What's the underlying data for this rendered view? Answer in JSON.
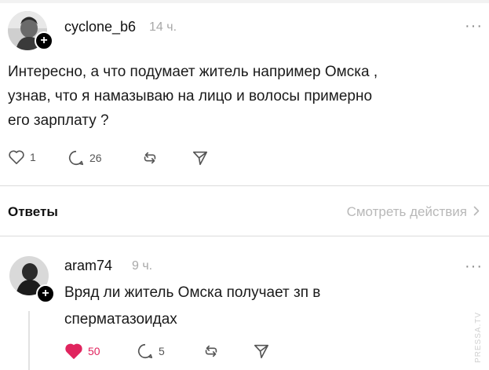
{
  "post": {
    "username": "cyclone_b6",
    "time": "14 ч.",
    "text_lines": [
      "Интересно, а что подумает житель например Омска ,",
      "узнав,  что я намазываю на лицо и волосы примерно",
      "его зарплату ?"
    ],
    "likes": "1",
    "comments": "26"
  },
  "replies_header": {
    "title": "Ответы",
    "see_actions": "Смотреть действия"
  },
  "reply": {
    "username": "aram74",
    "time": "9 ч.",
    "text_lines": [
      "Вряд ли житель Омска получает зп в",
      "сперматазоидах"
    ],
    "likes": "50",
    "comments": "5"
  },
  "watermark": "PRESSA.TV",
  "colors": {
    "like_red": "#e0245e",
    "muted_text": "#a8a8a8",
    "divider": "#dcdcdc"
  }
}
